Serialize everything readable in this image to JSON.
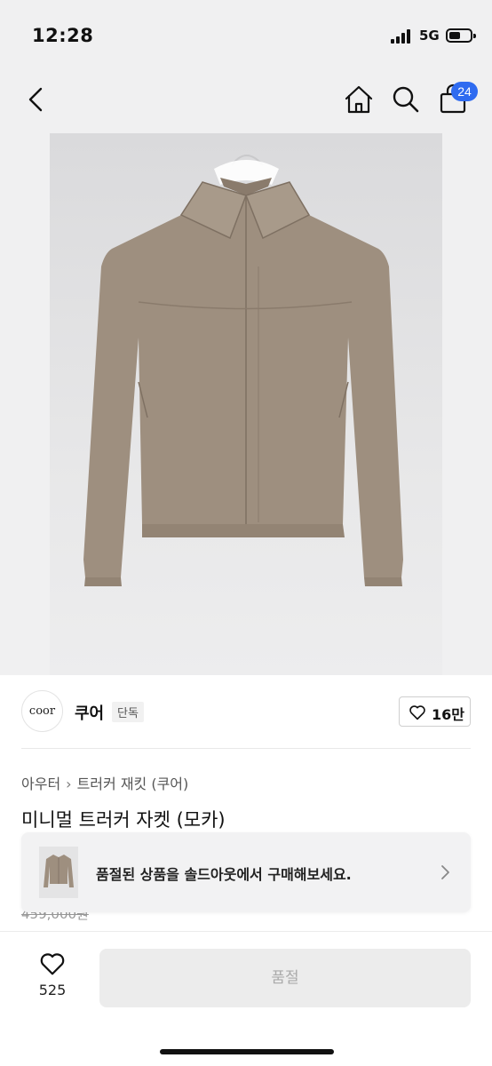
{
  "status_bar": {
    "time": "12:28",
    "network": "5G"
  },
  "navbar": {
    "cart_count": "24"
  },
  "brand": {
    "logo_text": "coor",
    "name": "쿠어",
    "tag": "단독",
    "likes": "16만"
  },
  "breadcrumb": {
    "category": "아우터",
    "subcategory": "트러커 재킷 (쿠어)"
  },
  "product": {
    "title": "미니멀 트러커 자켓 (모카)",
    "original_price": "459,000원"
  },
  "soldout_banner": {
    "text": "품절된 상품을 솔드아웃에서 구매해보세요."
  },
  "bottom_bar": {
    "wish_count": "525",
    "buy_label": "품절"
  },
  "colors": {
    "accent": "#2f6bf0",
    "jacket": "#9e8f7f",
    "disabled_button": "#ececec"
  }
}
